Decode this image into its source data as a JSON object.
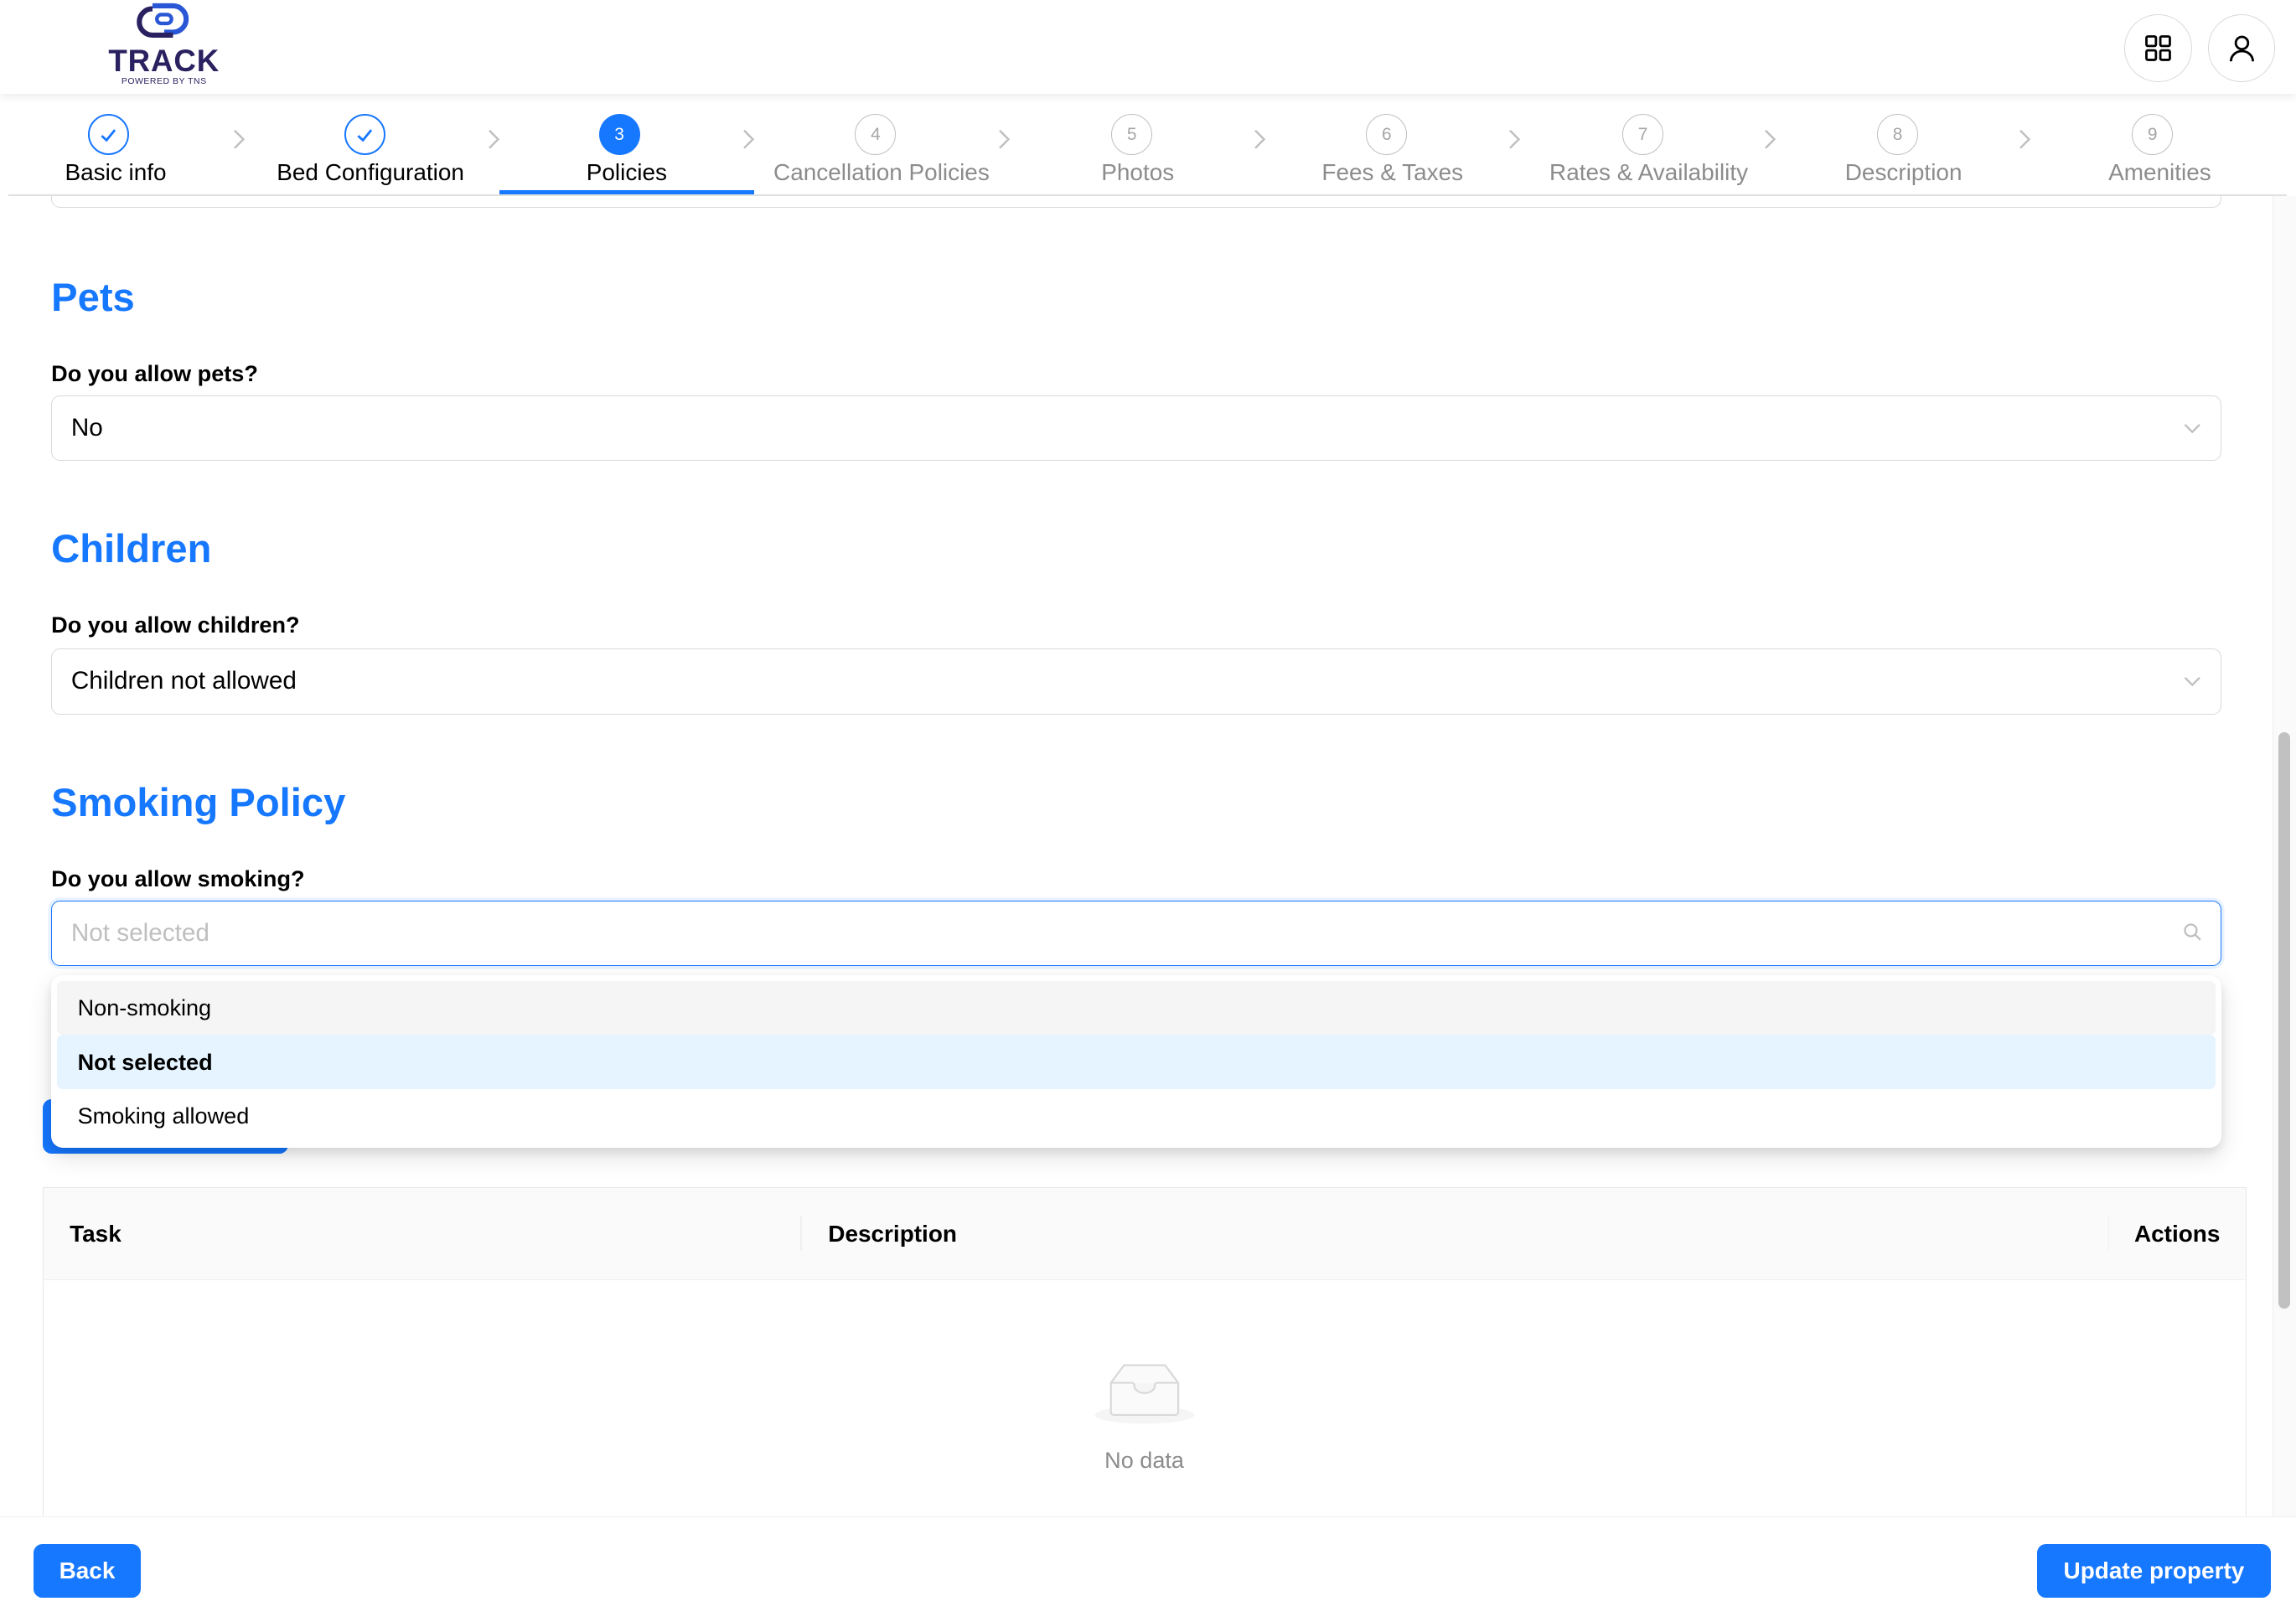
{
  "header": {
    "brand": "TRACK",
    "tagline": "POWERED BY TNS",
    "apps_icon": "grid-icon",
    "user_icon": "user-icon"
  },
  "steps": [
    {
      "number": "1",
      "label": "Basic info",
      "state": "done"
    },
    {
      "number": "2",
      "label": "Bed Configuration",
      "state": "done"
    },
    {
      "number": "3",
      "label": "Policies",
      "state": "active"
    },
    {
      "number": "4",
      "label": "Cancellation Policies",
      "state": "todo"
    },
    {
      "number": "5",
      "label": "Photos",
      "state": "todo"
    },
    {
      "number": "6",
      "label": "Fees & Taxes",
      "state": "todo"
    },
    {
      "number": "7",
      "label": "Rates & Availability",
      "state": "todo"
    },
    {
      "number": "8",
      "label": "Description",
      "state": "todo"
    },
    {
      "number": "9",
      "label": "Amenities",
      "state": "todo"
    }
  ],
  "pets": {
    "title": "Pets",
    "question": "Do you allow pets?",
    "value": "No"
  },
  "children": {
    "title": "Children",
    "question": "Do you allow children?",
    "value": "Children not allowed"
  },
  "smoking": {
    "title": "Smoking Policy",
    "question": "Do you allow smoking?",
    "placeholder": "Not selected",
    "options": [
      "Non-smoking",
      "Not selected",
      "Smoking allowed"
    ],
    "selected_option": "Not selected",
    "hovered_option": "Non-smoking"
  },
  "tasks_table": {
    "columns": [
      "Task",
      "Description",
      "Actions"
    ],
    "empty_text": "No data"
  },
  "footer": {
    "back_label": "Back",
    "update_label": "Update property"
  },
  "colors": {
    "primary": "#1677ff",
    "brand_dark": "#2a2160"
  }
}
